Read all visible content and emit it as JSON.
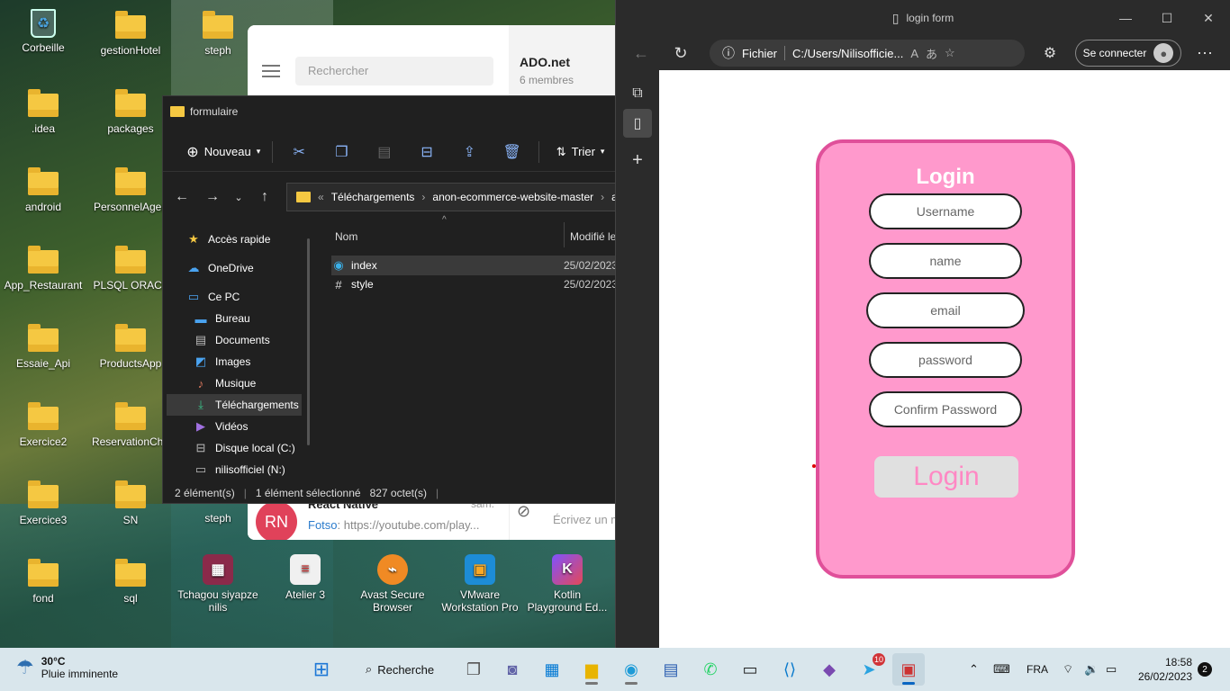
{
  "desktop": {
    "icons": [
      {
        "label": "Corbeille"
      },
      {
        "label": "gestionHotel"
      },
      {
        "label": "steph"
      },
      {
        "label": ".idea"
      },
      {
        "label": "packages"
      },
      {
        "label": "android"
      },
      {
        "label": "PersonnelAgen"
      },
      {
        "label": "App_Restaurant"
      },
      {
        "label": "PLSQL ORACL"
      },
      {
        "label": "Essaie_Api"
      },
      {
        "label": "ProductsApp"
      },
      {
        "label": "Exercice2"
      },
      {
        "label": "ReservationCha"
      },
      {
        "label": "Exercice3"
      },
      {
        "label": "SN"
      },
      {
        "label": "steph"
      },
      {
        "label": "fond"
      },
      {
        "label": "sql"
      },
      {
        "label": "Tchagou siyapze nilis"
      },
      {
        "label": "Atelier 3"
      },
      {
        "label": "Avast Secure Browser"
      },
      {
        "label": "VMware Workstation Pro"
      },
      {
        "label": "Kotlin Playground Ed..."
      }
    ]
  },
  "chat": {
    "search_placeholder": "Rechercher",
    "group_title": "ADO.net",
    "group_members": "6 membres",
    "conversation": {
      "avatar": "RN",
      "name": "React Native",
      "date": "sam.",
      "sender": "Fotso",
      "preview": ": https://youtube.com/play..."
    },
    "compose_placeholder": "Écrivez un m"
  },
  "explorer": {
    "title": "formulaire",
    "toolbar": {
      "new_label": "Nouveau",
      "sort_label": "Trier"
    },
    "breadcrumb": [
      "Téléchargements",
      "anon-ecommerce-website-master",
      "a"
    ],
    "sidebar": [
      {
        "label": "Accès rapide",
        "icon": "star-icon"
      },
      {
        "label": "OneDrive",
        "icon": "cloud-icon"
      },
      {
        "label": "Ce PC",
        "icon": "computer-icon"
      },
      {
        "label": "Bureau",
        "icon": "desktop-icon"
      },
      {
        "label": "Documents",
        "icon": "document-icon"
      },
      {
        "label": "Images",
        "icon": "image-icon"
      },
      {
        "label": "Musique",
        "icon": "music-icon"
      },
      {
        "label": "Téléchargements",
        "icon": "download-icon"
      },
      {
        "label": "Vidéos",
        "icon": "video-icon"
      },
      {
        "label": "Disque local (C:)",
        "icon": "drive-icon"
      },
      {
        "label": "nilisofficiel (N:)",
        "icon": "network-drive-icon"
      }
    ],
    "columns": {
      "name": "Nom",
      "modified": "Modifié le"
    },
    "files": [
      {
        "name": "index",
        "modified": "25/02/2023",
        "icon": "edge-file-icon"
      },
      {
        "name": "style",
        "modified": "25/02/2023",
        "icon": "css-file-icon"
      }
    ],
    "status": {
      "count": "2 élément(s)",
      "selected": "1 élément sélectionné",
      "size": "827 octet(s)"
    }
  },
  "browser": {
    "tab_title": "login form",
    "omnibox": {
      "site_label": "Fichier",
      "url": "C:/Users/Nilisofficie..."
    },
    "signin_label": "Se connecter"
  },
  "login_form": {
    "heading": "Login",
    "fields": [
      {
        "placeholder": "Username"
      },
      {
        "placeholder": "name"
      },
      {
        "placeholder": "email"
      },
      {
        "placeholder": "password"
      },
      {
        "placeholder": "Confirm Password"
      }
    ],
    "submit_label": "Login",
    "colors": {
      "card": "#ff99cc",
      "border": "#e0509a",
      "button_text": "#ff88c4"
    }
  },
  "taskbar": {
    "weather": {
      "temp": "30°C",
      "desc": "Pluie imminente"
    },
    "search_label": "Recherche",
    "telegram_badge": "10",
    "language": "FRA",
    "time": "18:58",
    "date": "26/02/2023",
    "notification_count": "2"
  }
}
